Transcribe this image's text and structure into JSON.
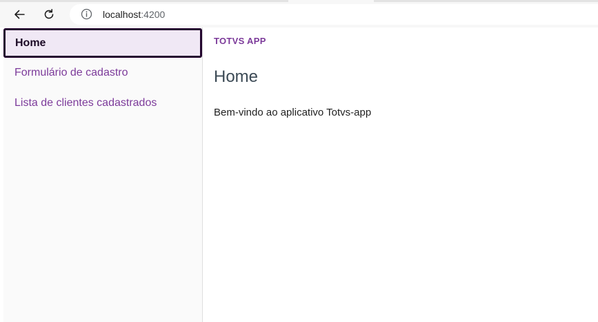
{
  "browser": {
    "url_host": "localhost",
    "url_port": ":4200"
  },
  "sidebar": {
    "items": [
      {
        "label": "Home",
        "active": true
      },
      {
        "label": "Formulário de cadastro",
        "active": false
      },
      {
        "label": "Lista de clientes cadastrados",
        "active": false
      }
    ]
  },
  "main": {
    "app_title": "TOTVS APP",
    "page_title": "Home",
    "welcome": "Bem-vindo ao aplicativo Totvs-app"
  },
  "colors": {
    "accent": "#7c3a9a",
    "active_border": "#24052f",
    "active_bg": "#f0e8f5"
  }
}
